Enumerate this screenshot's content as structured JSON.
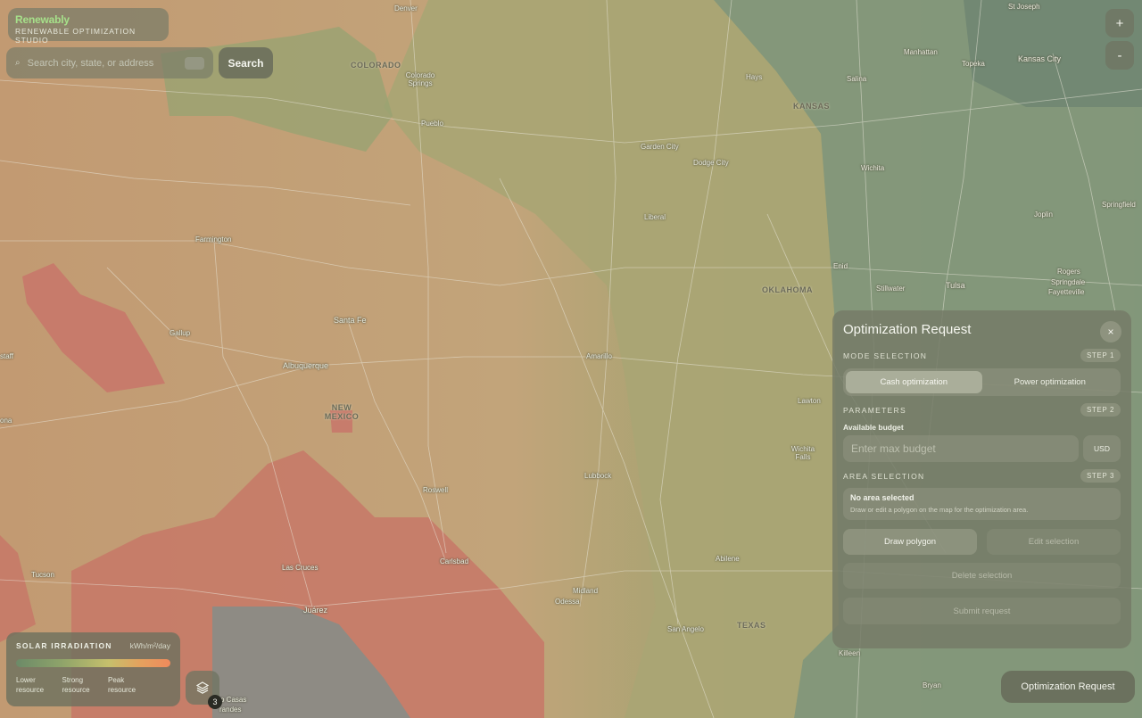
{
  "brand": {
    "name": "Renewably",
    "subtitle": "RENEWABLE OPTIMIZATION STUDIO"
  },
  "search": {
    "placeholder": "Search city, state, or address",
    "button_label": "Search"
  },
  "zoom": {
    "in_label": "+",
    "out_label": "-"
  },
  "map": {
    "states": [
      "COLORADO",
      "KANSAS",
      "OKLAHOMA",
      "NEW MEXICO",
      "TEXAS"
    ],
    "cities": [
      "Denver",
      "St Joseph",
      "Colorado Springs",
      "Pueblo",
      "Manhattan",
      "Topeka",
      "Kansas City",
      "Hays",
      "Salina",
      "Garden City",
      "Dodge City",
      "Wichita",
      "Liberal",
      "Joplin",
      "Springfield",
      "Farmington",
      "Enid",
      "Rogers",
      "Springdale",
      "Fayetteville",
      "Stillwater",
      "Tulsa",
      "Santa Fe",
      "Gallup",
      "Amarillo",
      "Albuquerque",
      "Lawton",
      "Wichita Falls",
      "Lubbock",
      "Roswell",
      "Tucson",
      "Las Cruces",
      "Carlsbad",
      "Abilene",
      "Midland",
      "Odessa",
      "Juárez",
      "San Angelo",
      "Killeen",
      "Bryan",
      "ona",
      "staff",
      "vo Casas",
      "randes"
    ]
  },
  "legend": {
    "title": "SOLAR IRRADIATION",
    "unit": "kWh/m²/day",
    "labels": [
      "Lower resource",
      "Strong resource",
      "Peak resource"
    ]
  },
  "layers": {
    "badge_count": "3"
  },
  "panel": {
    "title": "Optimization Request",
    "close_label": "×",
    "mode": {
      "label": "MODE SELECTION",
      "step": "STEP 1",
      "options": [
        "Cash optimization",
        "Power optimization"
      ],
      "selected": "Cash optimization"
    },
    "parameters": {
      "label": "PARAMETERS",
      "step": "STEP 2",
      "budget_label": "Available budget",
      "budget_placeholder": "Enter max budget",
      "currency": "USD"
    },
    "area": {
      "label": "AREA SELECTION",
      "step": "STEP 3",
      "status_title": "No area selected",
      "status_help": "Draw or edit a polygon on the map for the optimization area."
    },
    "buttons": {
      "draw": "Draw polygon",
      "edit": "Edit selection",
      "delete": "Delete selection",
      "submit": "Submit request"
    }
  },
  "optimization_button": "Optimization Request"
}
